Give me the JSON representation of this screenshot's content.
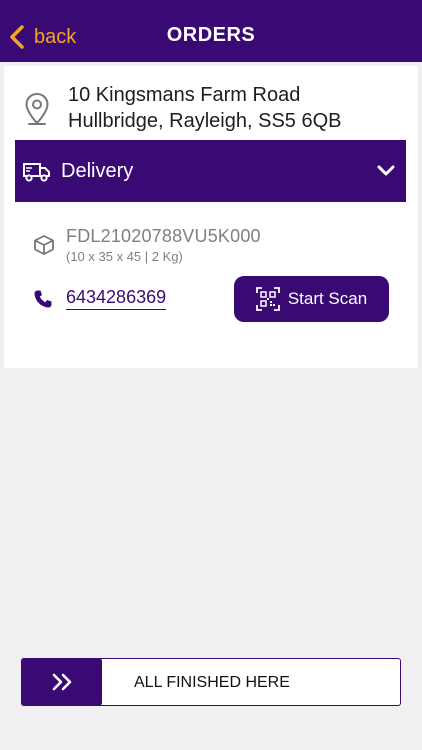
{
  "header": {
    "back_label": "back",
    "title": "ORDERS"
  },
  "address": {
    "line1": "10 Kingsmans Farm Road",
    "line2": "Hullbridge, Rayleigh, SS5 6QB"
  },
  "delivery": {
    "label": "Delivery",
    "expanded": false
  },
  "package": {
    "id": "FDL21020788VU5K000",
    "dimensions": "(10 x 35 x 45  |  2 Kg)"
  },
  "contact": {
    "phone": "6434286369"
  },
  "scan": {
    "label": "Start Scan"
  },
  "finish": {
    "label": "ALL FINISHED HERE"
  },
  "colors": {
    "primary": "#3a0a74",
    "accent": "#f5a623",
    "background": "#f0f0f0"
  },
  "icons": {
    "back": "chevron-left-icon",
    "address": "map-pin-icon",
    "delivery": "truck-icon",
    "toggle": "chevron-down-icon",
    "package": "box-icon",
    "phone": "phone-icon",
    "scan": "qr-code-icon",
    "finish": "double-chevron-right-icon"
  }
}
